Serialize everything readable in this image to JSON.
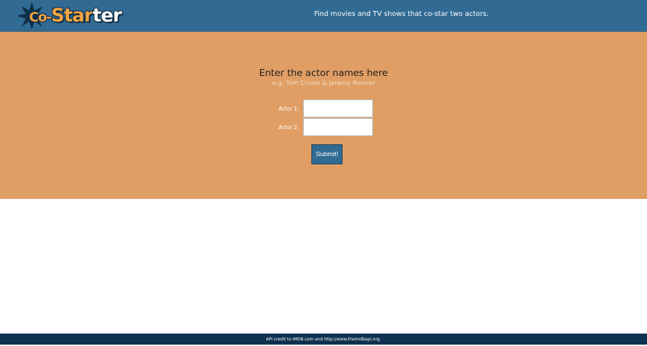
{
  "header": {
    "logo": {
      "part1": "Co-",
      "part2": "Star",
      "part3": "ter",
      "icon": "star-burst-icon"
    },
    "tagline": "Find movies and TV shows that co-star two actors."
  },
  "form": {
    "title": "Enter the actor names here",
    "subtitle": "e.g. Tom Cruise & Jeremy Renner",
    "actor1_label": "Actor 1:",
    "actor1_value": "",
    "actor2_label": "Actor 2:",
    "actor2_value": "",
    "submit_label": "Submit!"
  },
  "footer": {
    "prefix": "API credit to ",
    "link1": "IMDB.com",
    "middle": " and ",
    "link2": "http://www.theimdbapi.org",
    "suffix": "."
  },
  "colors": {
    "header_bg": "#316b93",
    "hero_bg": "#e09e65",
    "footer_bg": "#0d3150",
    "logo_orange": "#f3a442"
  }
}
